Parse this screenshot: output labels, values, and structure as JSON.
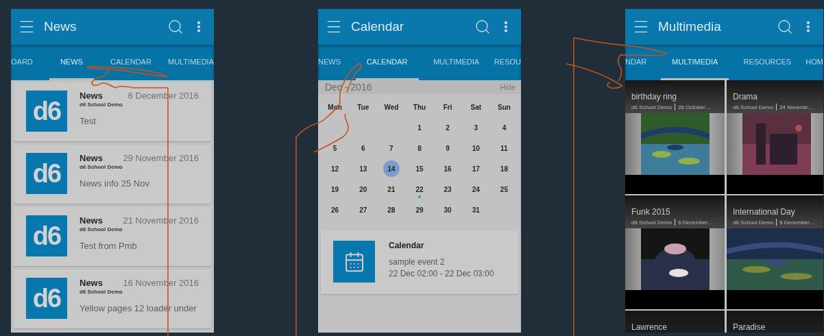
{
  "screens": [
    {
      "kind": "news",
      "title": "News",
      "tabs": [
        {
          "label": "OARD",
          "selected": false
        },
        {
          "label": "NEWS",
          "selected": true
        },
        {
          "label": "CALENDAR",
          "selected": false
        },
        {
          "label": "MULTIMEDIA",
          "selected": false
        }
      ],
      "items": [
        {
          "logo": "d6",
          "title": "News",
          "source": "d6 School Demo",
          "date": "6 December 2016",
          "body": "Test"
        },
        {
          "logo": "d6",
          "title": "News",
          "source": "d6 School Demo",
          "date": "29 November 2016",
          "body": "News info 25 Nov"
        },
        {
          "logo": "d6",
          "title": "News",
          "source": "d6 School Demo",
          "date": "21 November 2016",
          "body": "Test from Pmb"
        },
        {
          "logo": "d6",
          "title": "News",
          "source": "d6 School Demo",
          "date": "16 November 2016",
          "body": "Yellow pages 12 loader under"
        }
      ]
    },
    {
      "kind": "calendar",
      "title": "Calendar",
      "tabs": [
        {
          "label": "NEWS",
          "selected": false
        },
        {
          "label": "CALENDAR",
          "selected": true
        },
        {
          "label": "MULTIMEDIA",
          "selected": false
        },
        {
          "label": "RESOU",
          "selected": false
        }
      ],
      "month": "Dec - 2016",
      "hide": "Hide",
      "weekdays": [
        "Mon",
        "Tue",
        "Wed",
        "Thu",
        "Fri",
        "Sat",
        "Sun"
      ],
      "weeks": [
        [
          {
            "day": "1",
            "selected": false,
            "event": false
          },
          {
            "day": "2",
            "selected": false,
            "event": false
          },
          {
            "day": "3",
            "selected": false,
            "event": false
          },
          {
            "day": "4",
            "selected": false,
            "event": false
          }
        ],
        [
          {
            "day": "5",
            "selected": false,
            "event": false
          },
          {
            "day": "6",
            "selected": false,
            "event": false
          },
          {
            "day": "7",
            "selected": false,
            "event": false
          },
          {
            "day": "8",
            "selected": false,
            "event": false
          },
          {
            "day": "9",
            "selected": false,
            "event": false
          },
          {
            "day": "10",
            "selected": false,
            "event": false
          },
          {
            "day": "11",
            "selected": false,
            "event": false
          }
        ],
        [
          {
            "day": "12",
            "selected": false,
            "event": false
          },
          {
            "day": "13",
            "selected": false,
            "event": false
          },
          {
            "day": "14",
            "selected": true,
            "event": false
          },
          {
            "day": "15",
            "selected": false,
            "event": false
          },
          {
            "day": "16",
            "selected": false,
            "event": false
          },
          {
            "day": "17",
            "selected": false,
            "event": false
          },
          {
            "day": "18",
            "selected": false,
            "event": false
          }
        ],
        [
          {
            "day": "19",
            "selected": false,
            "event": false
          },
          {
            "day": "20",
            "selected": false,
            "event": false
          },
          {
            "day": "21",
            "selected": false,
            "event": false
          },
          {
            "day": "22",
            "selected": false,
            "event": true
          },
          {
            "day": "23",
            "selected": false,
            "event": false
          },
          {
            "day": "24",
            "selected": false,
            "event": false
          },
          {
            "day": "25",
            "selected": false,
            "event": false
          }
        ],
        [
          {
            "day": "26",
            "selected": false,
            "event": false
          },
          {
            "day": "27",
            "selected": false,
            "event": false
          },
          {
            "day": "28",
            "selected": false,
            "event": false
          },
          {
            "day": "29",
            "selected": false,
            "event": false
          },
          {
            "day": "30",
            "selected": false,
            "event": false
          },
          {
            "day": "31",
            "selected": false,
            "event": false
          }
        ]
      ],
      "event": {
        "title": "Calendar",
        "name": "sample event 2",
        "time": "22 Dec 02:00  - 22 Dec 03:00"
      }
    },
    {
      "kind": "multimedia",
      "title": "Multimedia",
      "tabs": [
        {
          "label": "NDAR",
          "selected": false
        },
        {
          "label": "MULTIMEDIA",
          "selected": true
        },
        {
          "label": "RESOURCES",
          "selected": false
        },
        {
          "label": "HOM",
          "selected": false
        }
      ],
      "tiles": [
        {
          "title": "birthday ring",
          "author": "d6 School Demo",
          "date": "26 October…",
          "kind": "picture"
        },
        {
          "title": "Drama",
          "author": "d6 School Demo",
          "date": "24 Novemb…",
          "kind": "picture"
        },
        {
          "title": "Funk 2015",
          "author": "d6 School Demo",
          "date": "6 December…",
          "kind": "picture"
        },
        {
          "title": "International Day",
          "author": "d6 School Demo",
          "date": "6 December…",
          "kind": "picture"
        },
        {
          "title": "Lawrence"
        },
        {
          "title": "Paradise"
        }
      ]
    }
  ]
}
